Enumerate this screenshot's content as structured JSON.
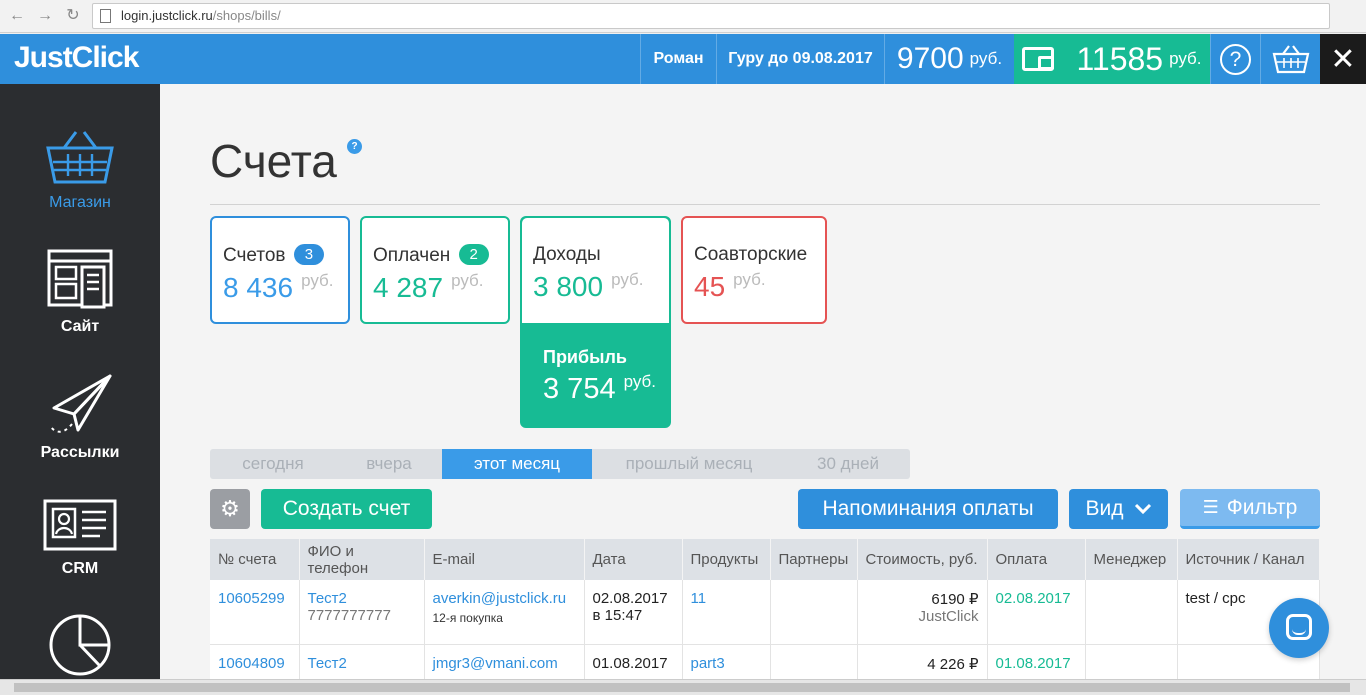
{
  "browser": {
    "url_host": "login.justclick.ru",
    "url_path": "/shops/bills/"
  },
  "header": {
    "logo": "JustClick",
    "user": "Роман",
    "tariff": "Гуру до 09.08.2017",
    "balance": "9700",
    "balance_unit": "руб.",
    "wallet": "11585",
    "wallet_unit": "руб.",
    "help_symbol": "?",
    "close_symbol": "✕"
  },
  "sidebar": {
    "items": [
      {
        "label": "Магазин",
        "icon": "basket-icon",
        "active": true
      },
      {
        "label": "Сайт",
        "icon": "site-icon"
      },
      {
        "label": "Рассылки",
        "icon": "paper-plane-icon"
      },
      {
        "label": "CRM",
        "icon": "contact-card-icon"
      }
    ]
  },
  "page": {
    "title": "Счета",
    "title_help": "?"
  },
  "cards": {
    "bills": {
      "label": "Счетов",
      "badge": "3",
      "value": "8 436",
      "unit": "руб."
    },
    "paid": {
      "label": "Оплачен",
      "badge": "2",
      "value": "4 287",
      "unit": "руб."
    },
    "income": {
      "label": "Доходы",
      "value": "3 800",
      "unit": "руб."
    },
    "coauthor": {
      "label": "Соавторские",
      "value": "45",
      "unit": "руб."
    },
    "profit": {
      "label": "Прибыль",
      "value": "3 754",
      "unit": "руб."
    }
  },
  "colors": {
    "blue": "#2f8fdc",
    "green": "#17bb94",
    "red": "#e55353",
    "sidebar": "#2b2d30"
  },
  "period_tabs": [
    "сегодня",
    "вчера",
    "этот месяц",
    "прошлый месяц",
    "30 дней"
  ],
  "period_active": "этот месяц",
  "toolbar": {
    "create_label": "Создать счет",
    "reminders_label": "Напоминания оплаты",
    "view_label": "Вид",
    "filter_label": "Фильтр"
  },
  "table": {
    "headers": [
      "№ счета",
      "ФИО и телефон",
      "E-mail",
      "Дата",
      "Продукты",
      "Партнеры",
      "Стоимость, руб.",
      "Оплата",
      "Менеджер",
      "Источник / Канал"
    ],
    "rows": [
      {
        "id": "10605299",
        "name": "Тест2",
        "phone": "7777777777",
        "email": "averkin@justclick.ru",
        "email_note": "12-я покупка",
        "date": "02.08.2017",
        "time": "в 15:47",
        "products": "11",
        "partners": "",
        "price": "6190 ₽",
        "price_note": "JustClick",
        "paid": "02.08.2017",
        "manager": "",
        "source": "test / cpc"
      },
      {
        "id": "10604809",
        "name": "Тест2",
        "phone": "",
        "email": "jmgr3@vmani.com",
        "email_note": "",
        "date": "01.08.2017",
        "time": "",
        "products": "part3",
        "partners": "",
        "price": "4 226 ₽",
        "price_note": "",
        "paid": "01.08.2017",
        "manager": "",
        "source": ""
      }
    ]
  }
}
